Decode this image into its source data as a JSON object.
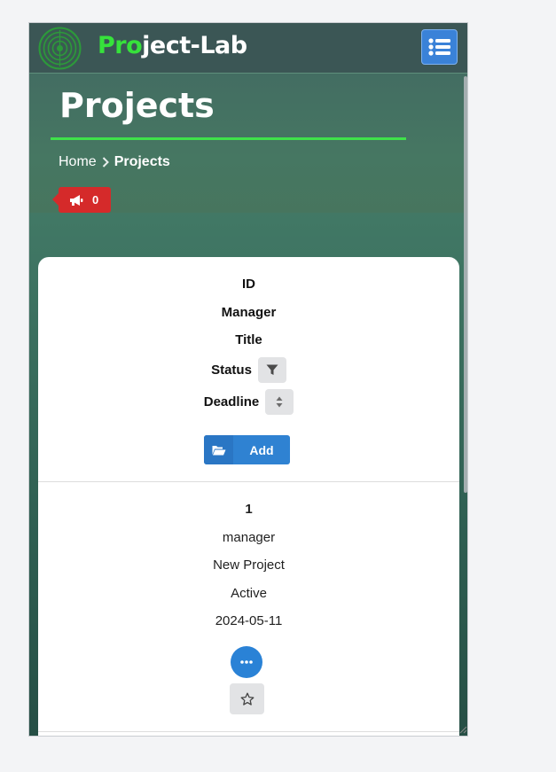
{
  "navbar": {
    "brand_accent": "Pro",
    "brand_rest": "ject-Lab",
    "logo_icon": "circular-target-logo",
    "menu_icon": "list-icon"
  },
  "hero": {
    "title": "Projects",
    "breadcrumb": {
      "home": "Home",
      "current": "Projects"
    },
    "notification_count": "0"
  },
  "table": {
    "columns": {
      "id": "ID",
      "manager": "Manager",
      "title": "Title",
      "status": "Status",
      "deadline": "Deadline"
    },
    "add_label": "Add",
    "rows": [
      {
        "id": "1",
        "manager": "manager",
        "title": "New Project",
        "status": "Active",
        "deadline": "2024-05-11"
      }
    ]
  },
  "colors": {
    "accent_green": "#36e23b",
    "primary_blue": "#2f82d2",
    "badge_red": "#d52a2a"
  }
}
